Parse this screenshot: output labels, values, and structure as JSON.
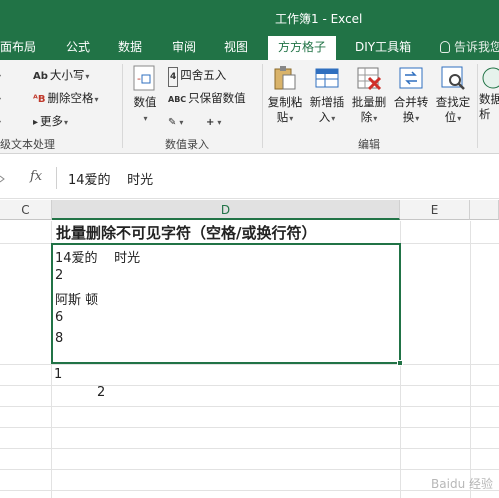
{
  "window": {
    "title": "工作簿1 - Excel"
  },
  "ribbon_tabs": [
    {
      "label": "面布局"
    },
    {
      "label": "公式"
    },
    {
      "label": "数据"
    },
    {
      "label": "审阅"
    },
    {
      "label": "视图"
    },
    {
      "label": "方方格子",
      "active": true
    },
    {
      "label": "DIY工具箱"
    }
  ],
  "tell_me": "告诉我您",
  "ribbon": {
    "text_group": {
      "case_btn": "大小写",
      "delete_spaces_btn": "删除空格",
      "more_btn": "更多",
      "group_label": "级文本处理"
    },
    "data_entry_group": {
      "numeric_btn": "数值",
      "round_btn": "四舍五入",
      "keep_value_btn": "只保留数值",
      "group_label": "数值录入"
    },
    "edit_group": {
      "copy_paste_l1": "复制粘",
      "copy_paste_l2": "贴",
      "insert_l1": "新增插",
      "insert_l2": "入",
      "batch_delete_l1": "批量删",
      "batch_delete_l2": "除",
      "merge_l1": "合并转",
      "merge_l2": "换",
      "find_l1": "查找定",
      "find_l2": "位",
      "group_label": "编辑"
    },
    "analysis_group": {
      "label_l1": "数据",
      "label_l2": "析"
    }
  },
  "formula_bar": {
    "fx": "fx",
    "content": "14爱的    时光"
  },
  "columns": [
    {
      "label": "C"
    },
    {
      "label": "D"
    },
    {
      "label": "E"
    }
  ],
  "cells": {
    "heading": "批量删除不可见字符（空格/或换行符）",
    "selected_lines": [
      "14爱的    时光",
      "2",
      "阿斯 顿",
      "6",
      "8"
    ],
    "below_1": "1",
    "below_2": "2"
  },
  "watermark": "Baidu 经验"
}
